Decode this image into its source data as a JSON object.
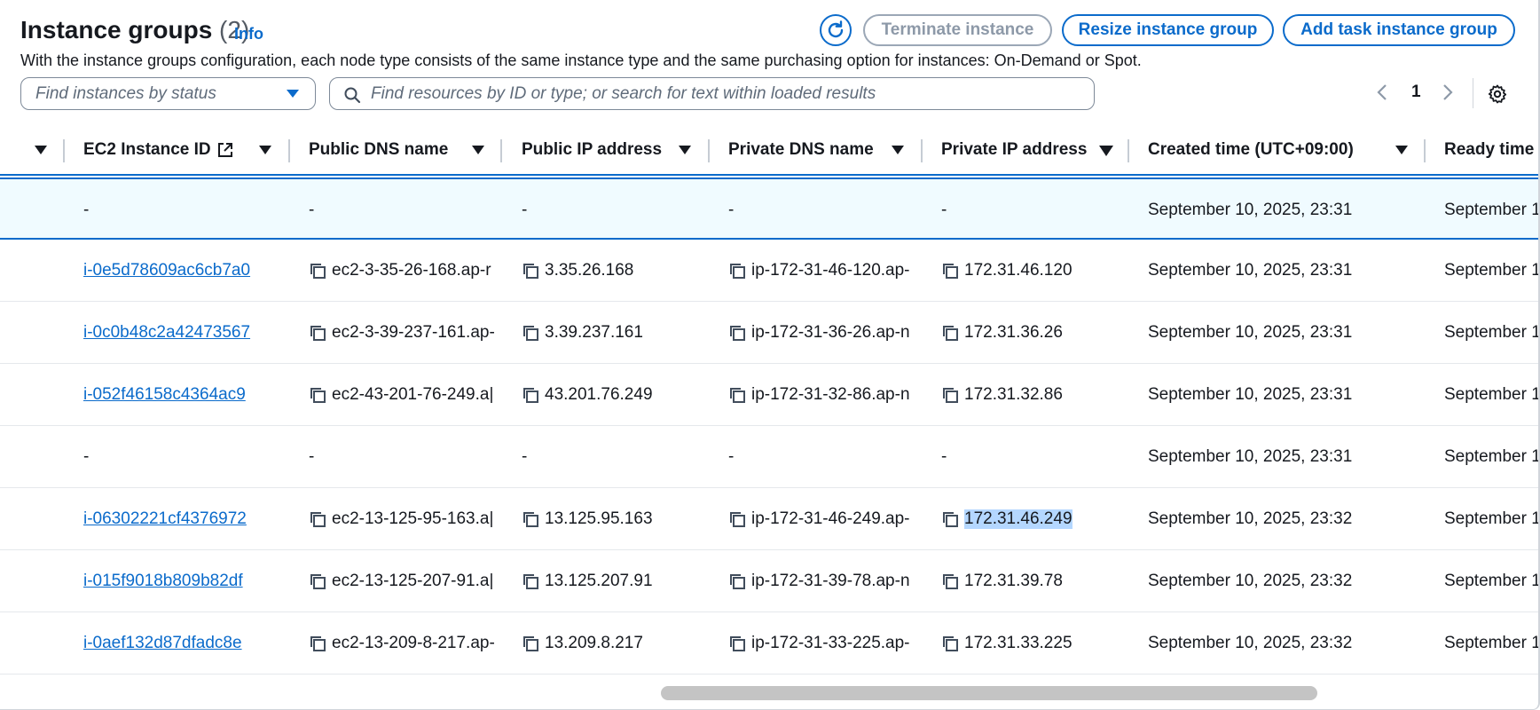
{
  "header": {
    "title": "Instance groups",
    "count": "(2)",
    "info": "Info",
    "description": "With the instance groups configuration, each node type consists of the same instance type and the same purchasing option for instances: On-Demand or Spot."
  },
  "toolbar": {
    "terminate_label": "Terminate instance",
    "resize_label": "Resize instance group",
    "add_task_label": "Add task instance group"
  },
  "filters": {
    "status_placeholder": "Find instances by status",
    "search_placeholder": "Find resources by ID or type; or search for text within loaded results"
  },
  "pagination": {
    "current_page": "1"
  },
  "columns": {
    "ec2_id": "EC2 Instance ID",
    "public_dns": "Public DNS name",
    "public_ip": "Public IP address",
    "private_dns": "Private DNS name",
    "private_ip": "Private IP address",
    "created": "Created time (UTC+09:00)",
    "ready": "Ready time ("
  },
  "rows": [
    {
      "id": "-",
      "public_dns": "-",
      "public_ip": "-",
      "private_dns": "-",
      "private_ip": "-",
      "created": "September 10, 2025, 23:31",
      "ready": "September 1"
    },
    {
      "id": "i-0e5d78609ac6cb7a0",
      "public_dns": "ec2-3-35-26-168.ap-r",
      "public_ip": "3.35.26.168",
      "private_dns": "ip-172-31-46-120.ap-",
      "private_ip": "172.31.46.120",
      "created": "September 10, 2025, 23:31",
      "ready": "September 1"
    },
    {
      "id": "i-0c0b48c2a42473567",
      "public_dns": "ec2-3-39-237-161.ap-",
      "public_ip": "3.39.237.161",
      "private_dns": "ip-172-31-36-26.ap-n",
      "private_ip": "172.31.36.26",
      "created": "September 10, 2025, 23:31",
      "ready": "September 1"
    },
    {
      "id": "i-052f46158c4364ac9",
      "public_dns": "ec2-43-201-76-249.a|",
      "public_ip": "43.201.76.249",
      "private_dns": "ip-172-31-32-86.ap-n",
      "private_ip": "172.31.32.86",
      "created": "September 10, 2025, 23:31",
      "ready": "September 1"
    },
    {
      "id": "-",
      "public_dns": "-",
      "public_ip": "-",
      "private_dns": "-",
      "private_ip": "-",
      "created": "September 10, 2025, 23:31",
      "ready": "September 1"
    },
    {
      "id": "i-06302221cf4376972",
      "public_dns": "ec2-13-125-95-163.a|",
      "public_ip": "13.125.95.163",
      "private_dns": "ip-172-31-46-249.ap-",
      "private_ip": "172.31.46.249",
      "created": "September 10, 2025, 23:32",
      "ready": "September 1"
    },
    {
      "id": "i-015f9018b809b82df",
      "public_dns": "ec2-13-125-207-91.a|",
      "public_ip": "13.125.207.91",
      "private_dns": "ip-172-31-39-78.ap-n",
      "private_ip": "172.31.39.78",
      "created": "September 10, 2025, 23:32",
      "ready": "September 1"
    },
    {
      "id": "i-0aef132d87dfadc8e",
      "public_dns": "ec2-13-209-8-217.ap-",
      "public_ip": "13.209.8.217",
      "private_dns": "ip-172-31-33-225.ap-",
      "private_ip": "172.31.33.225",
      "created": "September 10, 2025, 23:32",
      "ready": "September 1"
    }
  ],
  "colors": {
    "accent": "#0b6bcb",
    "selected_row_bg": "#f0fbff",
    "text_highlight": "#b4d7ff"
  }
}
